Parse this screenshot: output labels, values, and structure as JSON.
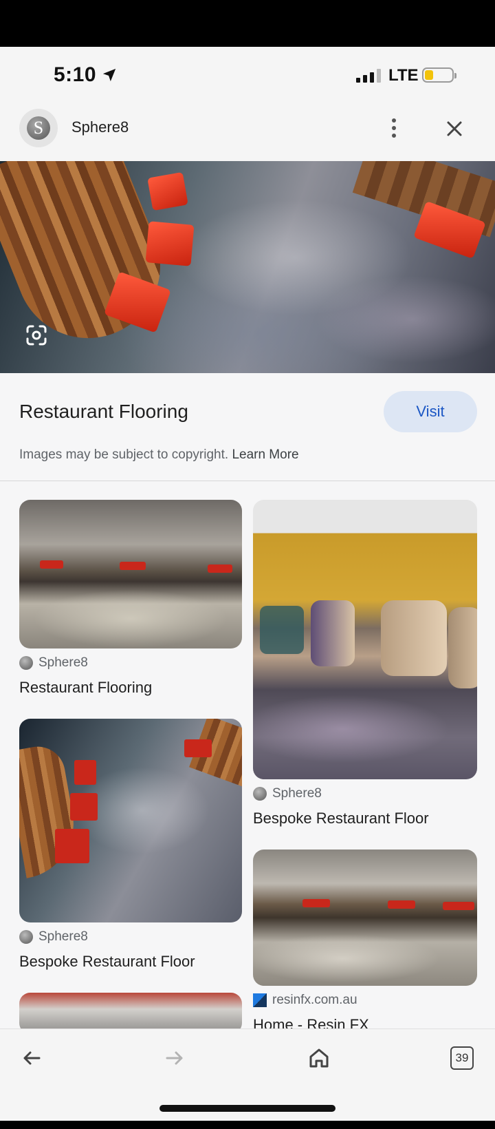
{
  "status": {
    "time": "5:10",
    "network": "LTE"
  },
  "header": {
    "site_name": "Sphere8"
  },
  "result": {
    "title": "Restaurant Flooring",
    "visit_label": "Visit",
    "copyright_text": "Images may be subject to copyright.",
    "learn_more": "Learn More"
  },
  "grid": {
    "left": [
      {
        "source": "Sphere8",
        "title": "Restaurant Flooring"
      },
      {
        "source": "Sphere8",
        "title": "Bespoke Restaurant Floor"
      }
    ],
    "right": [
      {
        "source": "Sphere8",
        "title": "Bespoke Restaurant Floor"
      },
      {
        "source": "resinfx.com.au",
        "title": "Home - Resin FX"
      }
    ]
  },
  "bottom_nav": {
    "tab_count": "39"
  },
  "colors": {
    "accent": "#1a56c4",
    "visit_bg": "#dde6f4",
    "battery": "#f2c30b"
  }
}
